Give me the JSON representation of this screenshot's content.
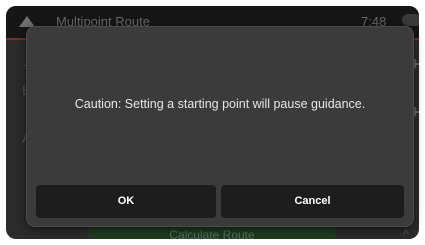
{
  "app": {
    "title": "Multipoint Route",
    "time": "7:48",
    "calculate_label": "Calculate Route"
  },
  "dialog": {
    "message": "Caution: Setting a starting point will pause guidance.",
    "ok_label": "OK",
    "cancel_label": "Cancel"
  },
  "colors": {
    "dialog_bg": "#3b3b3b",
    "button_bg": "#1d1d1d",
    "accent": "#7a2f2b"
  },
  "icons": [
    "navigate-up-icon",
    "add-icon",
    "back-icon",
    "chevron-up-icon"
  ]
}
